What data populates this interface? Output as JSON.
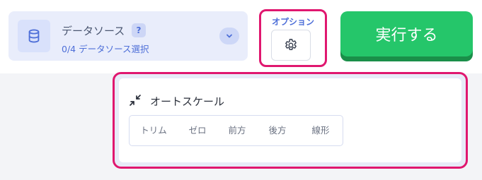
{
  "datasource": {
    "title": "データソース",
    "help": "?",
    "subtitle": "0/4 データソース選択",
    "icon": "database-icon"
  },
  "options": {
    "label": "オプション",
    "icon": "gear-icon"
  },
  "run_button": {
    "label": "実行する",
    "color": "#25c66a"
  },
  "autoscale": {
    "icon": "collapse-arrows-icon",
    "title": "オートスケール",
    "modes": [
      "トリム",
      "ゼロ",
      "前方",
      "後方",
      "線形"
    ]
  },
  "colors": {
    "highlight": "#e0176f",
    "accent": "#4e6fd8"
  }
}
